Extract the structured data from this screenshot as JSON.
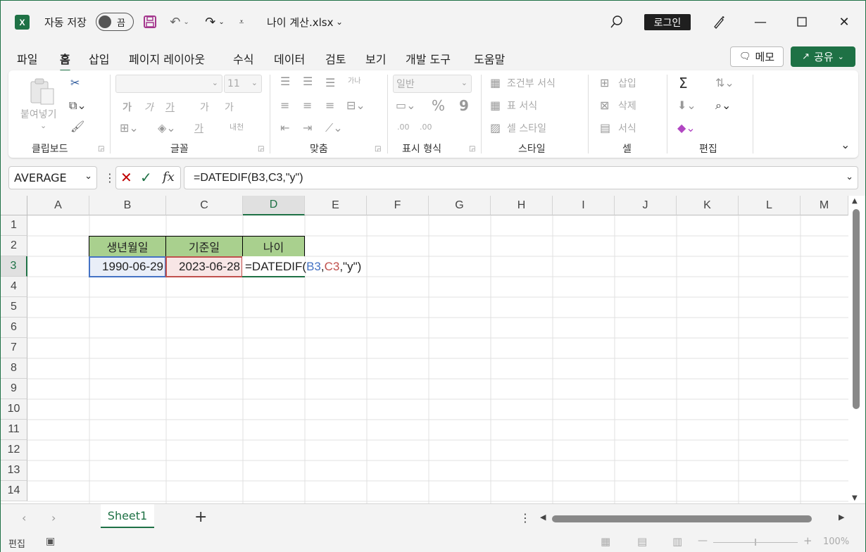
{
  "title": {
    "logo": "X",
    "autosave_label": "자동 저장",
    "autosave_state": "끔",
    "filename": "나이 계산.xlsx",
    "login": "로그인"
  },
  "menu": [
    "파일",
    "홈",
    "삽입",
    "페이지 레이아웃",
    "수식",
    "데이터",
    "검토",
    "보기",
    "개발 도구",
    "도움말"
  ],
  "buttons": {
    "memo": "메모",
    "share": "공유"
  },
  "ribbon": {
    "clipboard": {
      "label": "클립보드",
      "paste": "붙여넣기"
    },
    "font": {
      "label": "글꼴",
      "size": "11",
      "bold": "가",
      "italic": "가",
      "underline": "가",
      "grow": "가",
      "shrink": "가",
      "color": "가",
      "phonetic": "내천"
    },
    "align": {
      "label": "맞춤",
      "wrap": "가나"
    },
    "number": {
      "label": "표시 형식",
      "format": "일반",
      "percent": "%",
      "comma": "9",
      "inc": ".00",
      "dec": ".00"
    },
    "styles": {
      "label": "스타일",
      "cond": "조건부 서식",
      "table": "표 서식",
      "cell": "셀 스타일"
    },
    "cells": {
      "label": "셀",
      "insert": "삽입",
      "delete": "삭제",
      "format": "서식"
    },
    "editing": {
      "label": "편집"
    }
  },
  "formula_bar": {
    "name_box": "AVERAGE",
    "formula": "=DATEDIF(B3,C3,\"y\")"
  },
  "columns": [
    "A",
    "B",
    "C",
    "D",
    "E",
    "F",
    "G",
    "H",
    "I",
    "J",
    "K",
    "L",
    "M"
  ],
  "rows": [
    "1",
    "2",
    "3",
    "4",
    "5",
    "6",
    "7",
    "8",
    "9",
    "10",
    "11",
    "12",
    "13",
    "14"
  ],
  "cells": {
    "B2": "생년월일",
    "C2": "기준일",
    "D2": "나이",
    "B3": "1990-06-29",
    "C3": "2023-06-28",
    "D3": {
      "eq": "=DATEDIF(",
      "ref1": "B3",
      "comma1": ",",
      "ref2": "C3",
      "rest": ",\"y\")"
    }
  },
  "colors": {
    "accent": "#1e7145",
    "header_fill": "#a9d08e",
    "ref1": "#4472c4",
    "ref2": "#c0504d"
  },
  "sheet_tabs": [
    "Sheet1"
  ],
  "status": {
    "mode": "편집",
    "zoom": "100%"
  }
}
